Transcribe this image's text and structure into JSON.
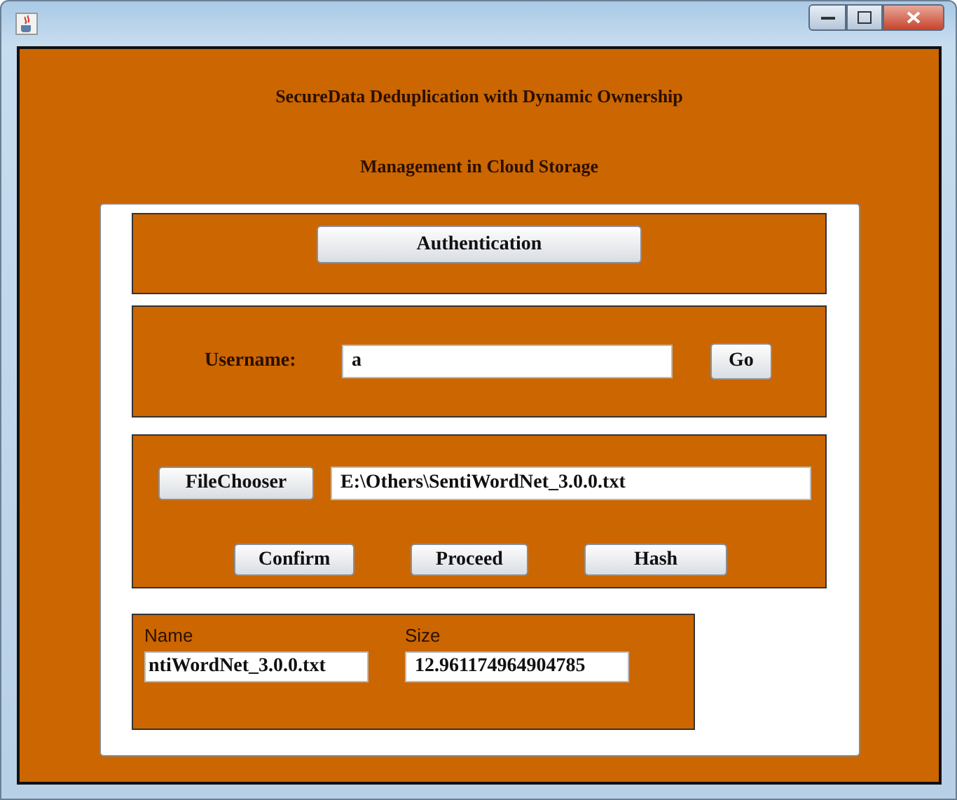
{
  "window": {
    "title_lines": [
      "SecureData Deduplication with Dynamic Ownership",
      "Management in Cloud Storage"
    ]
  },
  "authentication": {
    "button": "Authentication"
  },
  "login": {
    "label": "Username:",
    "value": "a",
    "button": "Go"
  },
  "file": {
    "chooser_button": "FileChooser",
    "path": "E:\\Others\\SentiWordNet_3.0.0.txt",
    "buttons": [
      "Confirm",
      "Proceed",
      "Hash"
    ]
  },
  "details": {
    "name_label": "Name",
    "name_value": "ntiWordNet_3.0.0.txt",
    "size_label": "Size",
    "size_value": "12.961174964904785"
  }
}
